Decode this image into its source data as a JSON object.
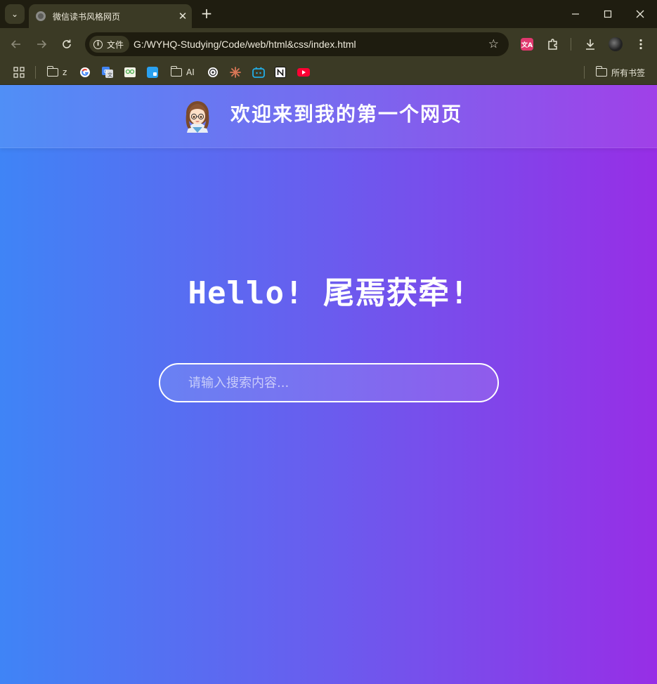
{
  "browser": {
    "tab_title": "微信读书风格网页",
    "tab_close": "✕",
    "new_tab": "+",
    "site_chip_label": "文件",
    "url": "G:/WYHQ-Studying/Code/web/html&css/index.html",
    "bookmarks": [
      {
        "label": "z",
        "icon": "folder-icon"
      },
      {
        "label": "",
        "icon": "google-icon"
      },
      {
        "label": "",
        "icon": "google-translate-icon"
      },
      {
        "label": "",
        "icon": "bookmark-green-icon"
      },
      {
        "label": "",
        "icon": "bookmark-blue-icon"
      },
      {
        "label": "AI",
        "icon": "folder-icon"
      },
      {
        "label": "",
        "icon": "openai-icon"
      },
      {
        "label": "",
        "icon": "claude-icon"
      },
      {
        "label": "",
        "icon": "bilibili-icon"
      },
      {
        "label": "",
        "icon": "notion-icon"
      },
      {
        "label": "",
        "icon": "youtube-icon"
      }
    ],
    "all_bookmarks_label": "所有书签"
  },
  "page": {
    "header_title": "欢迎来到我的第一个网页",
    "hello": "Hello! 尾焉获牵!",
    "search_placeholder": "请输入搜索内容..."
  },
  "colors": {
    "gradient_start": "#3f84f6",
    "gradient_end": "#972ee6",
    "chrome_bg": "#3b3a25",
    "titlebar_bg": "#1f1d10"
  }
}
